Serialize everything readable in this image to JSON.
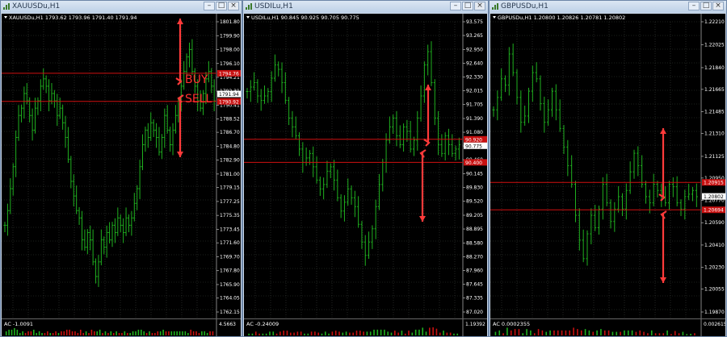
{
  "colors": {
    "candle": "#1fb01f",
    "grid": "#3a3f3a",
    "level": "#d01010",
    "arrow": "#ff3a3a",
    "price_tag_bg": "#ffffff",
    "price_tag_fg": "#000000",
    "label_red": "#c81010"
  },
  "icons": {
    "window": "chart-window-icon",
    "minimize": "minimize-icon",
    "maximize": "maximize-icon",
    "close": "close-icon"
  },
  "windows": [
    {
      "title": "XAUUSDu,H1",
      "symbol_line": "XAUUSDu,H1  1793.62 1793.96 1791.40 1791.94",
      "current_price": "1791.94",
      "ticks": [
        "1801.80",
        "1799.90",
        "1798.00",
        "1796.10",
        "1794.21",
        "1792.31",
        "1790.41",
        "1788.52",
        "1786.70",
        "1784.80",
        "1782.90",
        "1781.00",
        "1779.15",
        "1777.25",
        "1775.35",
        "1773.45",
        "1771.60",
        "1769.70",
        "1767.80",
        "1765.90",
        "1764.05",
        "1762.15"
      ],
      "levels": [
        "1794.76",
        "1790.92"
      ],
      "indicator_label": "AC -1.0091",
      "indicator_scale": "4.5663",
      "annotations": [
        "BUY",
        "SELL"
      ],
      "series": [
        1774,
        1776,
        1779,
        1782,
        1786,
        1789,
        1790,
        1792,
        1791,
        1789,
        1787,
        1790,
        1791,
        1793,
        1794,
        1793,
        1791,
        1792,
        1791,
        1789,
        1790,
        1788,
        1786,
        1783,
        1780,
        1778,
        1776,
        1775,
        1772,
        1771,
        1773,
        1772,
        1769,
        1767,
        1769,
        1772,
        1771,
        1773,
        1772,
        1774,
        1773,
        1775,
        1774,
        1773,
        1775,
        1774,
        1775,
        1777,
        1779,
        1782,
        1785,
        1787,
        1786,
        1788,
        1787,
        1786,
        1784,
        1786,
        1789,
        1787,
        1785,
        1787,
        1789,
        1791,
        1793,
        1795,
        1797,
        1798,
        1795,
        1793,
        1791,
        1790,
        1792,
        1794,
        1795,
        1793,
        1791
      ]
    },
    {
      "title": "USDILu,H1",
      "symbol_line": "USDILu,H1  90.845 90.925 90.705 90.775",
      "current_price": "90.775",
      "ticks": [
        "93.575",
        "93.265",
        "92.950",
        "92.640",
        "92.330",
        "92.015",
        "91.705",
        "91.390",
        "91.080",
        "90.770",
        "90.460",
        "90.145",
        "89.830",
        "89.520",
        "89.205",
        "88.895",
        "88.580",
        "88.270",
        "87.960",
        "87.645",
        "87.335",
        "87.020"
      ],
      "levels": [
        "90.920",
        "90.400"
      ],
      "indicator_label": "AC -0.24009",
      "indicator_scale": "1.19392",
      "annotations": [],
      "series": [
        92.0,
        92.1,
        92.2,
        91.9,
        91.8,
        91.9,
        92.0,
        92.3,
        92.6,
        92.5,
        92.2,
        91.8,
        91.4,
        91.2,
        91.0,
        90.7,
        90.4,
        90.5,
        90.6,
        90.3,
        90.0,
        89.8,
        89.9,
        90.2,
        90.3,
        90.0,
        89.6,
        89.3,
        89.5,
        89.8,
        89.6,
        89.4,
        89.0,
        88.6,
        88.3,
        88.6,
        88.9,
        89.4,
        89.9,
        90.4,
        90.9,
        91.2,
        91.4,
        91.0,
        90.8,
        91.2,
        91.1,
        90.7,
        90.9,
        91.4,
        91.9,
        92.6,
        92.9,
        92.2,
        91.4,
        90.8,
        90.6,
        91.0,
        90.8,
        90.6,
        90.7,
        90.8
      ]
    },
    {
      "title": "GBPUSDu,H1",
      "symbol_line": "GBPUSDu,H1  1.20800 1.20826 1.20781 1.20802",
      "current_price": "1.20802",
      "ticks": [
        "1.22210",
        "1.22025",
        "1.21840",
        "1.21665",
        "1.21485",
        "1.21310",
        "1.21125",
        "1.20950",
        "1.20770",
        "1.20590",
        "1.20410",
        "1.20230",
        "1.20055",
        "1.19870"
      ],
      "levels": [
        "1.20915",
        "1.20694"
      ],
      "indicator_label": "AC 0.0002355",
      "indicator_scale": "0.002615",
      "annotations": [],
      "series": [
        1.215,
        1.216,
        1.2175,
        1.217,
        1.2195,
        1.218,
        1.216,
        1.214,
        1.2145,
        1.2165,
        1.218,
        1.2175,
        1.2155,
        1.214,
        1.215,
        1.2165,
        1.215,
        1.2135,
        1.212,
        1.2105,
        1.209,
        1.2065,
        1.2045,
        1.203,
        1.205,
        1.2065,
        1.2055,
        1.207,
        1.209,
        1.2075,
        1.206,
        1.207,
        1.208,
        1.207,
        1.2085,
        1.21,
        1.2115,
        1.2105,
        1.209,
        1.208,
        1.2075,
        1.209,
        1.2085,
        1.208,
        1.2075,
        1.209,
        1.2088,
        1.2075,
        1.207,
        1.208,
        1.2082,
        1.2085,
        1.208
      ]
    }
  ]
}
